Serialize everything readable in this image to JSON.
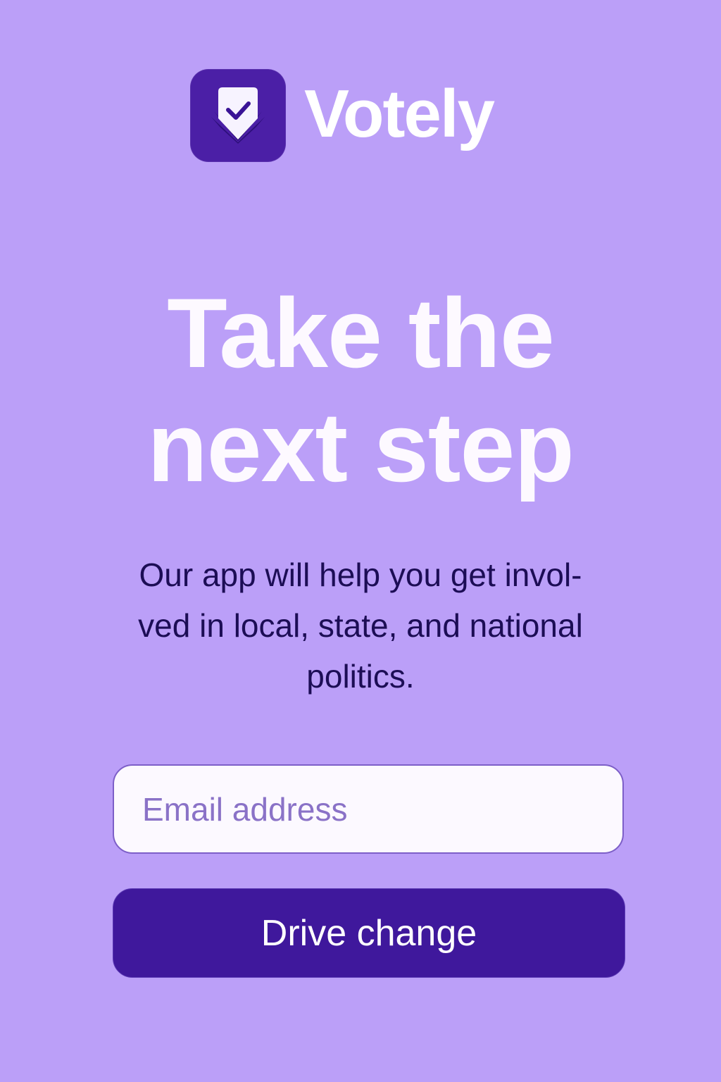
{
  "brand": {
    "name": "Votely",
    "logo_icon": "ballot-check-icon"
  },
  "hero": {
    "headline_lines": [
      "Take the",
      "next step"
    ],
    "subtext_lines": [
      "Our app will help you get invol-",
      "ved in local, state, and national",
      "politics."
    ]
  },
  "signup": {
    "email_placeholder": "Email address",
    "email_value": "",
    "submit_label": "Drive change"
  },
  "colors": {
    "background": "#bb9ff8",
    "brand_primary": "#3f189c",
    "logo_tile": "#4b1fa6",
    "headline_text": "#fdf9ff",
    "body_text": "#1c0d55",
    "input_background": "#fcf9ff",
    "input_border": "#7d5fc8"
  }
}
